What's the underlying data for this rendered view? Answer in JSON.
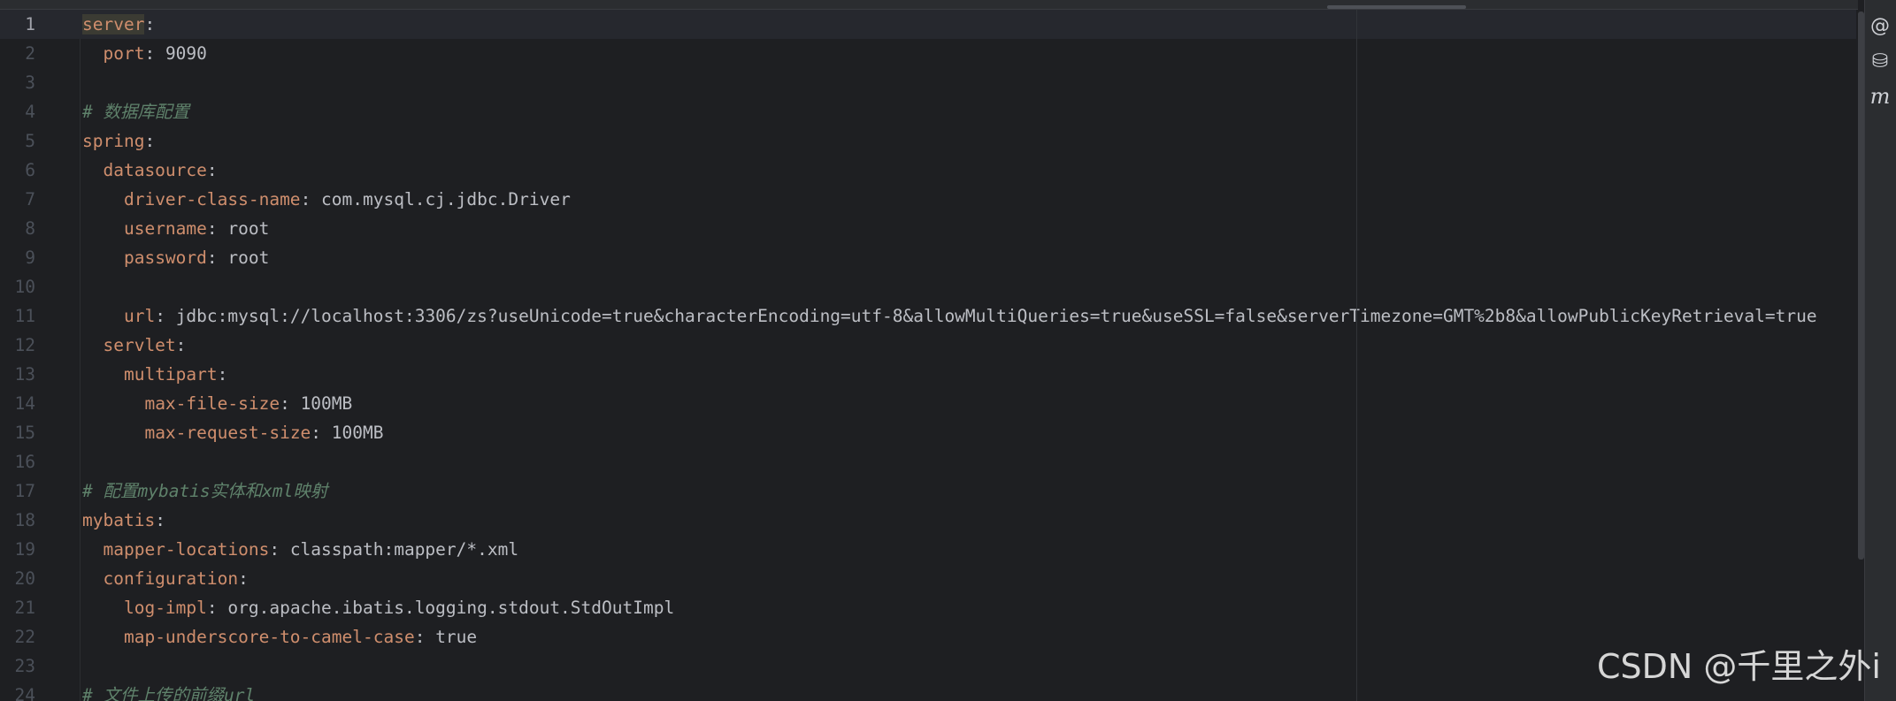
{
  "editor": {
    "current_line": 1,
    "lines": [
      {
        "n": "1",
        "tokens": [
          {
            "t": "server",
            "c": "k hl"
          },
          {
            "t": ":",
            "c": "p"
          }
        ]
      },
      {
        "n": "2",
        "tokens": [
          {
            "t": "  "
          },
          {
            "t": "port",
            "c": "k"
          },
          {
            "t": ": ",
            "c": "p"
          },
          {
            "t": "9090",
            "c": "v"
          }
        ]
      },
      {
        "n": "3",
        "tokens": []
      },
      {
        "n": "4",
        "tokens": [
          {
            "t": "# 数据库配置",
            "c": "c"
          }
        ]
      },
      {
        "n": "5",
        "tokens": [
          {
            "t": "spring",
            "c": "k"
          },
          {
            "t": ":",
            "c": "p"
          }
        ]
      },
      {
        "n": "6",
        "tokens": [
          {
            "t": "  "
          },
          {
            "t": "datasource",
            "c": "k"
          },
          {
            "t": ":",
            "c": "p"
          }
        ]
      },
      {
        "n": "7",
        "tokens": [
          {
            "t": "    "
          },
          {
            "t": "driver-class-name",
            "c": "k"
          },
          {
            "t": ": ",
            "c": "p"
          },
          {
            "t": "com.mysql.cj.jdbc.Driver",
            "c": "v"
          }
        ]
      },
      {
        "n": "8",
        "tokens": [
          {
            "t": "    "
          },
          {
            "t": "username",
            "c": "k"
          },
          {
            "t": ": ",
            "c": "p"
          },
          {
            "t": "root",
            "c": "v"
          }
        ]
      },
      {
        "n": "9",
        "tokens": [
          {
            "t": "    "
          },
          {
            "t": "password",
            "c": "k"
          },
          {
            "t": ": ",
            "c": "p"
          },
          {
            "t": "root",
            "c": "v"
          }
        ]
      },
      {
        "n": "10",
        "tokens": []
      },
      {
        "n": "11",
        "tokens": [
          {
            "t": "    "
          },
          {
            "t": "url",
            "c": "k"
          },
          {
            "t": ": ",
            "c": "p"
          },
          {
            "t": "jdbc:mysql://localhost:3306/zs?useUnicode=true&characterEncoding=utf-8&allowMultiQueries=true&useSSL=false&serverTimezone=GMT%2b8&allowPublicKeyRetrieval=true",
            "c": "v"
          }
        ]
      },
      {
        "n": "12",
        "tokens": [
          {
            "t": "  "
          },
          {
            "t": "servlet",
            "c": "k"
          },
          {
            "t": ":",
            "c": "p"
          }
        ]
      },
      {
        "n": "13",
        "tokens": [
          {
            "t": "    "
          },
          {
            "t": "multipart",
            "c": "k"
          },
          {
            "t": ":",
            "c": "p"
          }
        ]
      },
      {
        "n": "14",
        "tokens": [
          {
            "t": "      "
          },
          {
            "t": "max-file-size",
            "c": "k"
          },
          {
            "t": ": ",
            "c": "p"
          },
          {
            "t": "100MB",
            "c": "v"
          }
        ]
      },
      {
        "n": "15",
        "tokens": [
          {
            "t": "      "
          },
          {
            "t": "max-request-size",
            "c": "k"
          },
          {
            "t": ": ",
            "c": "p"
          },
          {
            "t": "100MB",
            "c": "v"
          }
        ]
      },
      {
        "n": "16",
        "tokens": []
      },
      {
        "n": "17",
        "tokens": [
          {
            "t": "# 配置mybatis实体和xml映射",
            "c": "c"
          }
        ]
      },
      {
        "n": "18",
        "tokens": [
          {
            "t": "mybatis",
            "c": "k"
          },
          {
            "t": ":",
            "c": "p"
          }
        ]
      },
      {
        "n": "19",
        "tokens": [
          {
            "t": "  "
          },
          {
            "t": "mapper-locations",
            "c": "k"
          },
          {
            "t": ": ",
            "c": "p"
          },
          {
            "t": "classpath:mapper/*.xml",
            "c": "v"
          }
        ]
      },
      {
        "n": "20",
        "tokens": [
          {
            "t": "  "
          },
          {
            "t": "configuration",
            "c": "k"
          },
          {
            "t": ":",
            "c": "p"
          }
        ]
      },
      {
        "n": "21",
        "tokens": [
          {
            "t": "    "
          },
          {
            "t": "log-impl",
            "c": "k"
          },
          {
            "t": ": ",
            "c": "p"
          },
          {
            "t": "org.apache.ibatis.logging.stdout.StdOutImpl",
            "c": "v"
          }
        ]
      },
      {
        "n": "22",
        "tokens": [
          {
            "t": "    "
          },
          {
            "t": "map-underscore-to-camel-case",
            "c": "k"
          },
          {
            "t": ": ",
            "c": "p"
          },
          {
            "t": "true",
            "c": "v"
          }
        ]
      },
      {
        "n": "23",
        "tokens": []
      },
      {
        "n": "24",
        "tokens": [
          {
            "t": "# 文件上传的前缀url",
            "c": "c"
          }
        ]
      }
    ]
  },
  "right_panel": {
    "icons": [
      {
        "name": "ai-assistant-icon",
        "glyph": "@"
      },
      {
        "name": "database-icon",
        "glyph": "⛁"
      },
      {
        "name": "maven-icon",
        "glyph": "m"
      }
    ]
  },
  "watermark": {
    "text": "CSDN @千里之外i"
  },
  "colors": {
    "background": "#1e1f22",
    "key": "#cf8e6d",
    "value": "#bcbec4",
    "comment": "#5f826b",
    "line_number": "#4b5059",
    "current_line": "#26282e"
  }
}
